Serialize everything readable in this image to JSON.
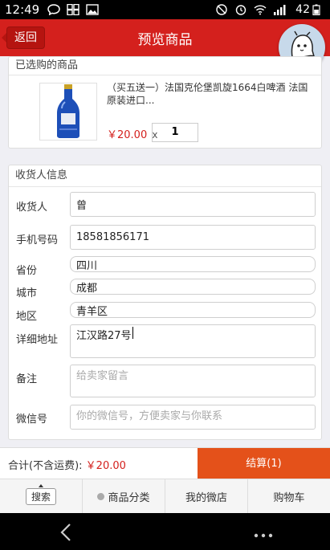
{
  "status_bar": {
    "time": "12:49",
    "battery": "42"
  },
  "header": {
    "back_label": "返回",
    "title": "预览商品"
  },
  "product_section": {
    "title": "已选购的商品",
    "name": "（买五送一）法国克伦堡凯旋1664白啤酒 法国原装进口...",
    "price": "￥20.00",
    "times": "x",
    "quantity": "1"
  },
  "receiver_section": {
    "title": "收货人信息",
    "rows": {
      "name": {
        "label": "收货人",
        "value": "曾"
      },
      "phone": {
        "label": "手机号码",
        "value": "18581856171"
      },
      "province": {
        "label": "省份",
        "value": "四川"
      },
      "city": {
        "label": "城市",
        "value": "成都"
      },
      "district": {
        "label": "地区",
        "value": "青羊区"
      },
      "address": {
        "label": "详细地址",
        "value": "江汉路27号"
      },
      "remark": {
        "label": "备注",
        "placeholder": "给卖家留言"
      },
      "wechat": {
        "label": "微信号",
        "placeholder": "你的微信号，方便卖家与你联系"
      }
    }
  },
  "total_bar": {
    "label": "合计(不含运费):",
    "amount": "￥20.00",
    "checkout_label": "结算(1)"
  },
  "bottom_nav": {
    "search": "搜索",
    "categories": "商品分类",
    "my_shop": "我的微店",
    "cart": "购物车"
  },
  "colors": {
    "brand_red": "#d4201d",
    "checkout_orange": "#e4511a"
  }
}
